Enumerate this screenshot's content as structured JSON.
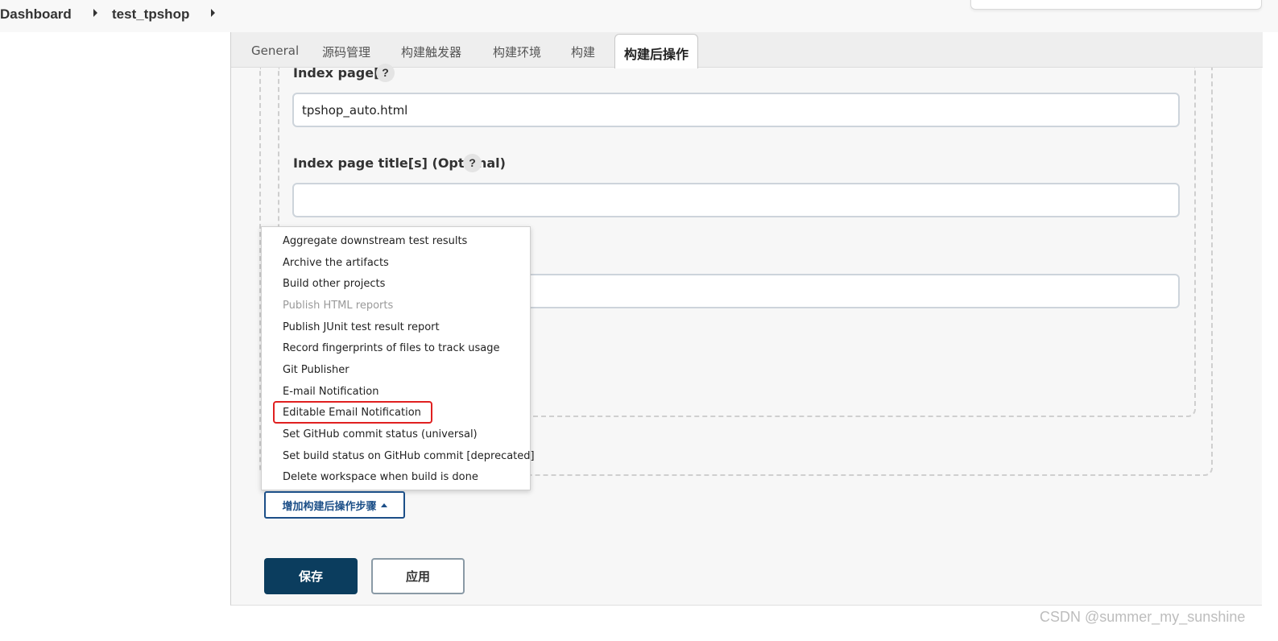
{
  "breadcrumb": {
    "items": [
      "Dashboard",
      "test_tpshop"
    ]
  },
  "tabs": [
    {
      "label": "General"
    },
    {
      "label": "源码管理"
    },
    {
      "label": "构建触发器"
    },
    {
      "label": "构建环境"
    },
    {
      "label": "构建"
    },
    {
      "label": "构建后操作",
      "active": true
    }
  ],
  "form": {
    "index_pages_label": "Index page[s]",
    "index_pages_value": "tpshop_auto.html",
    "index_titles_label": "Index page title[s] (Optional)",
    "index_titles_value": "",
    "help_glyph": "?"
  },
  "menu": {
    "items": [
      {
        "label": "Aggregate downstream test results",
        "enabled": true
      },
      {
        "label": "Archive the artifacts",
        "enabled": true
      },
      {
        "label": "Build other projects",
        "enabled": true
      },
      {
        "label": "Publish HTML reports",
        "enabled": false
      },
      {
        "label": "Publish JUnit test result report",
        "enabled": true
      },
      {
        "label": "Record fingerprints of files to track usage",
        "enabled": true
      },
      {
        "label": "Git Publisher",
        "enabled": true
      },
      {
        "label": "E-mail Notification",
        "enabled": true
      },
      {
        "label": "Editable Email Notification",
        "enabled": true,
        "highlighted": true
      },
      {
        "label": "Set GitHub commit status (universal)",
        "enabled": true
      },
      {
        "label": "Set build status on GitHub commit [deprecated]",
        "enabled": true
      },
      {
        "label": "Delete workspace when build is done",
        "enabled": true
      }
    ]
  },
  "buttons": {
    "add_step": "增加构建后操作步骤",
    "save": "保存",
    "apply": "应用"
  },
  "watermark": "CSDN @summer_my_sunshine",
  "colors": {
    "primary": "#0b3d5e",
    "link_blue": "#1c4f88",
    "highlight_red": "#e02020"
  }
}
